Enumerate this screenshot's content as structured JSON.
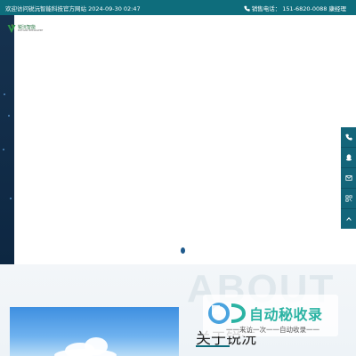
{
  "topbar": {
    "welcome": "欢迎访问锐沅智能科技官方网站 2024-09-30 02:47",
    "phone_label": "销售电话：",
    "phone_number": "151-6820-0088 康经理"
  },
  "logo": {
    "name": "锐沅智能",
    "tagline": "RUIYUAN INTELLIGENT"
  },
  "side_tools": [
    "phone-icon",
    "qq-icon",
    "message-icon",
    "qrcode-icon",
    "back-to-top-icon"
  ],
  "about": {
    "title": "关于锐沅",
    "watermark": "ABOUT"
  },
  "stamp": {
    "title": "自动秘收录",
    "subtitle": "一一来访一次一一自动收录一一"
  },
  "colors": {
    "topbar": "#0e6d7c",
    "hero_left": "#16324f",
    "accent": "#0e6d7c",
    "stamp_text": "#2bb3a3"
  }
}
